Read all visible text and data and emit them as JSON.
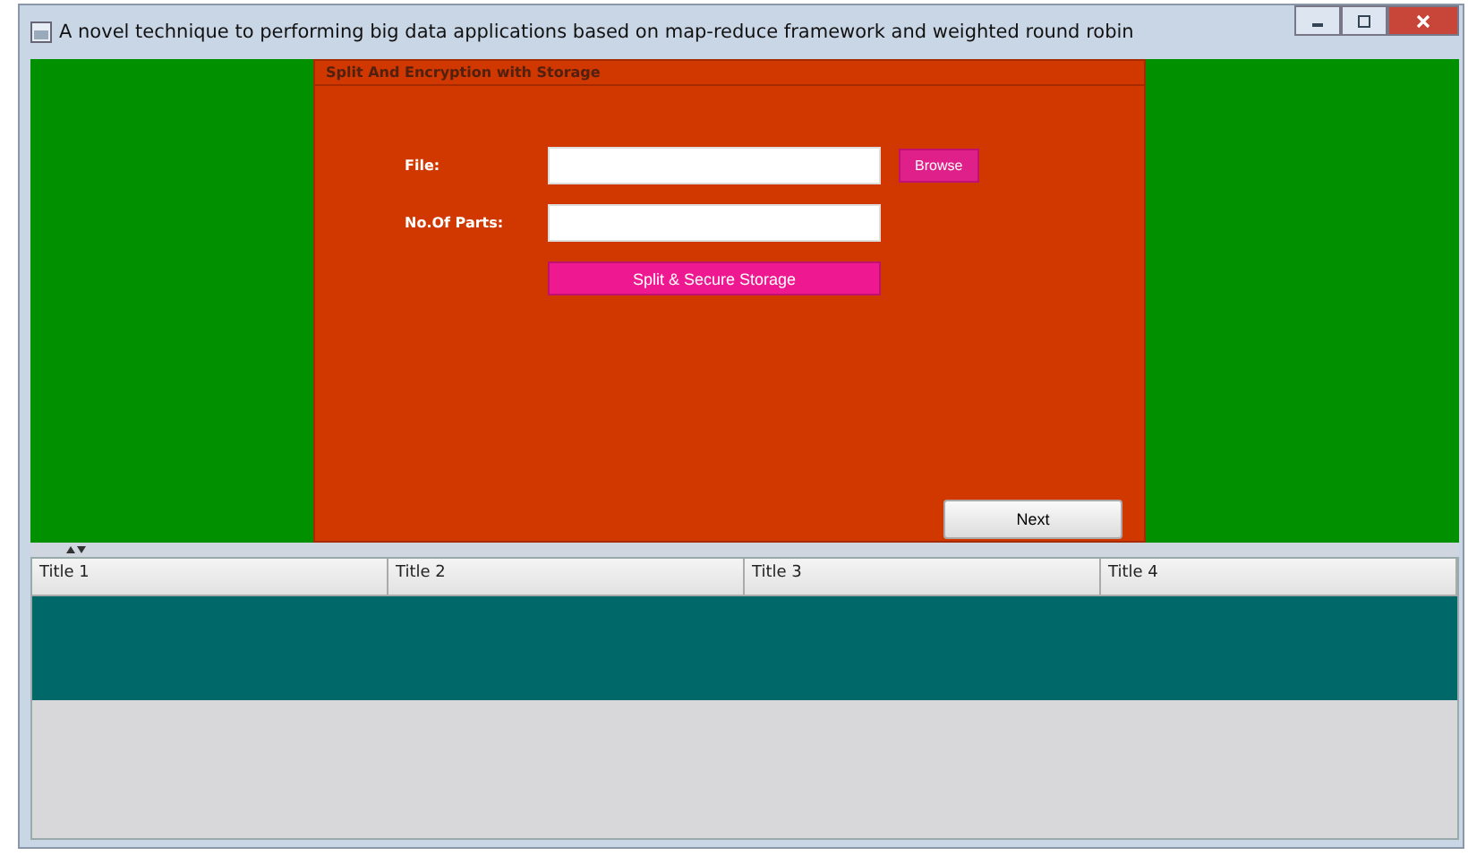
{
  "window": {
    "title": "A novel technique to performing big data applications based on map-reduce framework and weighted round robin"
  },
  "panel": {
    "title": "Split And Encryption with Storage",
    "fields": [
      {
        "label": "File:",
        "button": "Browse"
      },
      {
        "label": "No.Of Parts:"
      }
    ],
    "action_button": "Split & Secure Storage",
    "next_button": "Next"
  },
  "table": {
    "columns": [
      "Title 1",
      "Title 2",
      "Title 3",
      "Title 4"
    ],
    "rows": [
      {
        "selected": true
      }
    ]
  }
}
